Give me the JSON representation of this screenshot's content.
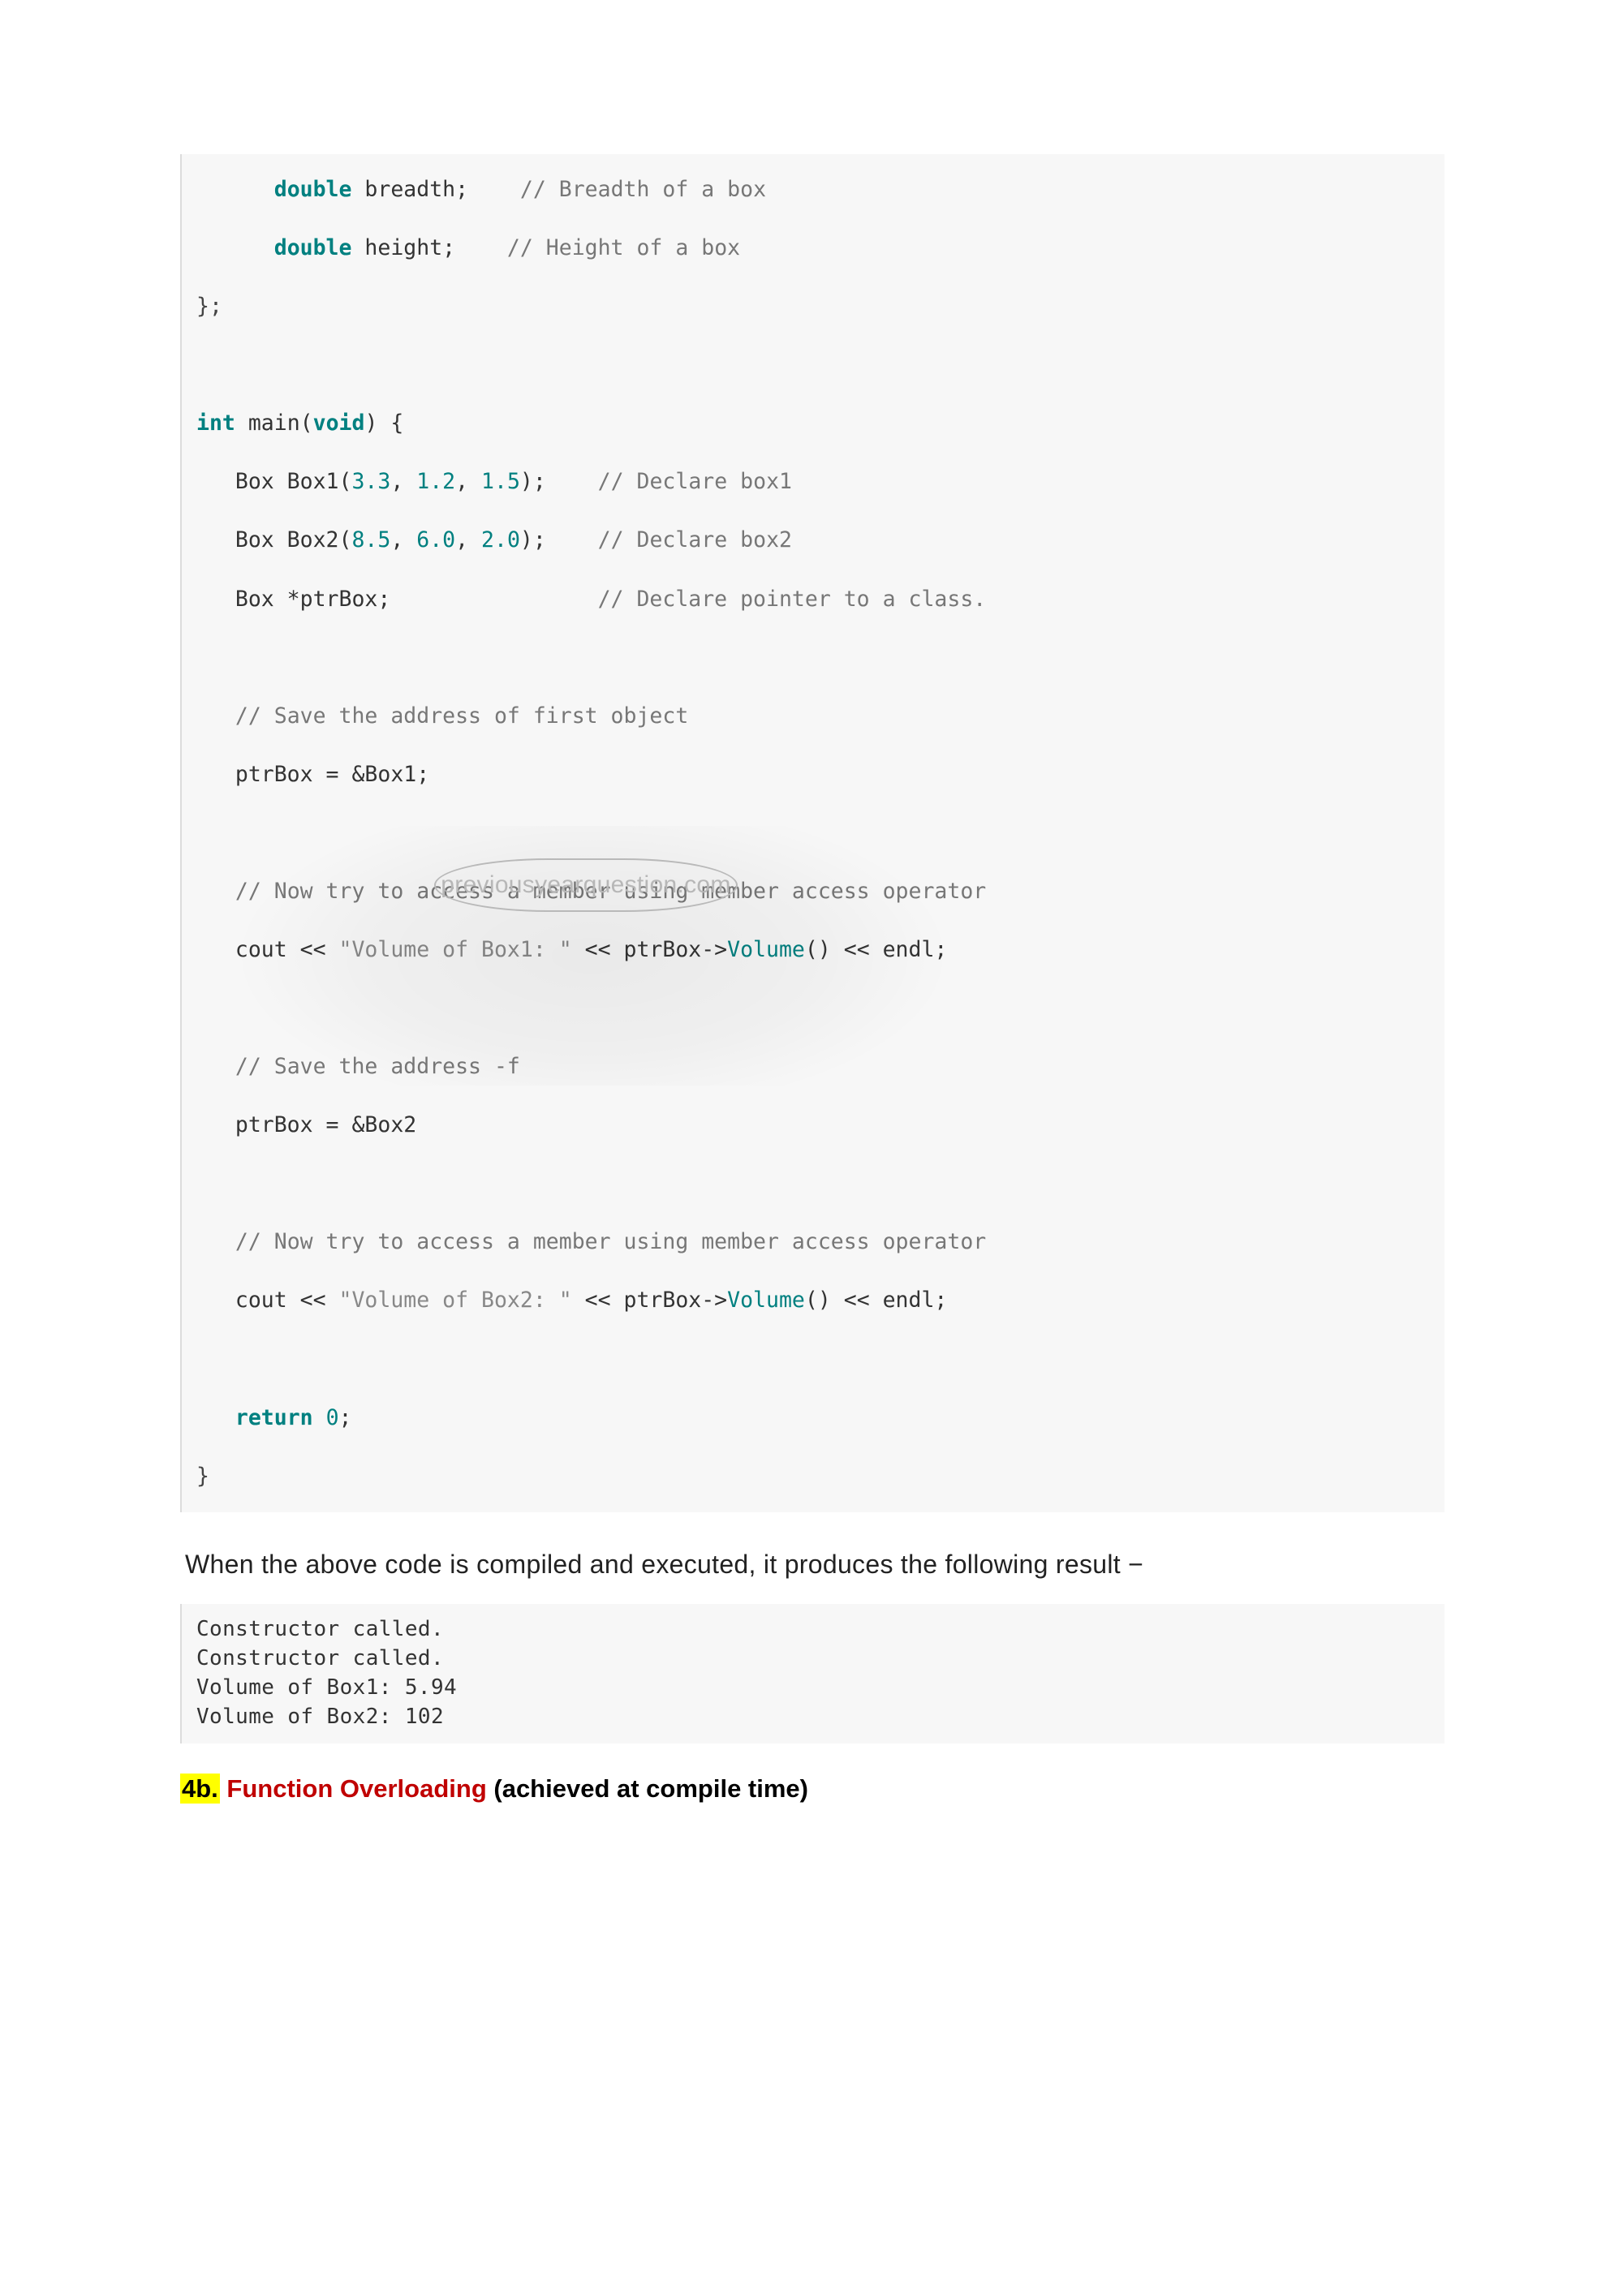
{
  "code": {
    "lines": [
      {
        "indent": "      ",
        "parts": [
          {
            "t": "double",
            "c": "kw"
          },
          {
            "t": " breadth;    "
          },
          {
            "t": "// Breadth of a box",
            "c": "com"
          }
        ]
      },
      {
        "indent": "      ",
        "parts": [
          {
            "t": "double",
            "c": "kw"
          },
          {
            "t": " height;    "
          },
          {
            "t": "// Height of a box",
            "c": "com"
          }
        ]
      },
      {
        "indent": "",
        "parts": [
          {
            "t": "};",
            "c": "pun"
          }
        ]
      },
      {
        "blank": true
      },
      {
        "indent": "",
        "parts": [
          {
            "t": "int",
            "c": "kw"
          },
          {
            "t": " main("
          },
          {
            "t": "void",
            "c": "kw"
          },
          {
            "t": ") {"
          }
        ]
      },
      {
        "indent": "   ",
        "parts": [
          {
            "t": "Box Box1("
          },
          {
            "t": "3.3",
            "c": "num"
          },
          {
            "t": ", "
          },
          {
            "t": "1.2",
            "c": "num"
          },
          {
            "t": ", "
          },
          {
            "t": "1.5",
            "c": "num"
          },
          {
            "t": ");    "
          },
          {
            "t": "// Declare box1",
            "c": "com"
          }
        ]
      },
      {
        "indent": "   ",
        "parts": [
          {
            "t": "Box Box2("
          },
          {
            "t": "8.5",
            "c": "num"
          },
          {
            "t": ", "
          },
          {
            "t": "6.0",
            "c": "num"
          },
          {
            "t": ", "
          },
          {
            "t": "2.0",
            "c": "num"
          },
          {
            "t": ");    "
          },
          {
            "t": "// Declare box2",
            "c": "com"
          }
        ]
      },
      {
        "indent": "   ",
        "parts": [
          {
            "t": "Box *ptrBox;                "
          },
          {
            "t": "// Declare pointer to a class.",
            "c": "com"
          }
        ]
      },
      {
        "blank": true
      },
      {
        "indent": "   ",
        "parts": [
          {
            "t": "// Save the address of first object",
            "c": "com"
          }
        ]
      },
      {
        "indent": "   ",
        "parts": [
          {
            "t": "ptrBox = &Box1;"
          }
        ]
      },
      {
        "blank": true
      },
      {
        "indent": "   ",
        "parts": [
          {
            "t": "// Now try to access a member using member access operator",
            "c": "com"
          }
        ]
      },
      {
        "indent": "   ",
        "parts": [
          {
            "t": "cout << "
          },
          {
            "t": "\"Volume of Box1: \"",
            "c": "str"
          },
          {
            "t": " << ptrBox->"
          },
          {
            "t": "Volume",
            "c": "fn"
          },
          {
            "t": "() << endl;"
          }
        ]
      },
      {
        "blank": true
      },
      {
        "indent": "   ",
        "parts": [
          {
            "t": "// Save the address ",
            "c": "com"
          },
          {
            "t": "-f",
            "c": "com"
          }
        ]
      },
      {
        "indent": "   ",
        "parts": [
          {
            "t": "ptrBox = &Box2"
          }
        ]
      },
      {
        "blank": true
      },
      {
        "indent": "   ",
        "parts": [
          {
            "t": "// Now try to access a member using member access operator",
            "c": "com"
          }
        ]
      },
      {
        "indent": "   ",
        "parts": [
          {
            "t": "cout << "
          },
          {
            "t": "\"Volume of Box2: \"",
            "c": "str"
          },
          {
            "t": " << ptrBox->"
          },
          {
            "t": "Volume",
            "c": "fn"
          },
          {
            "t": "() << endl;"
          }
        ]
      },
      {
        "blank": true
      },
      {
        "indent": "   ",
        "parts": [
          {
            "t": "return",
            "c": "return"
          },
          {
            "t": " "
          },
          {
            "t": "0",
            "c": "num"
          },
          {
            "t": ";"
          }
        ]
      },
      {
        "indent": "",
        "parts": [
          {
            "t": "}",
            "c": "pun"
          }
        ]
      }
    ]
  },
  "explain_text": "When the above code is compiled and executed, it produces the following result −",
  "output_lines": [
    "Constructor called.",
    "Constructor called.",
    "Volume of Box1: 5.94",
    "Volume of Box2: 102"
  ],
  "heading": {
    "num": "4b.",
    "title": "Function Overloading",
    "suffix": " (achieved at compile time)"
  },
  "watermark": "previousyearquestion.com"
}
